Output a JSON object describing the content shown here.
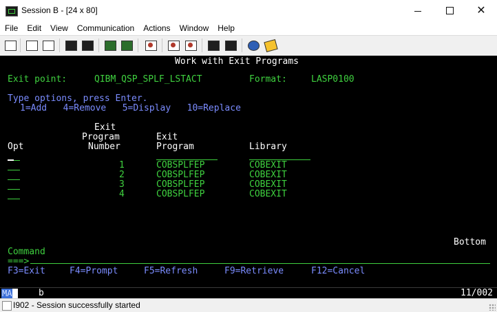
{
  "window": {
    "title": "Session B - [24 x 80]",
    "minimize": "—",
    "maximize": "□",
    "close": "✕"
  },
  "menu": [
    "File",
    "Edit",
    "View",
    "Communication",
    "Actions",
    "Window",
    "Help"
  ],
  "toolbar": {
    "icons": [
      "print-icon",
      "copy-icon",
      "paste-icon",
      "send-icon",
      "receive-icon",
      "display-icon",
      "keypad-icon",
      "record-icon",
      "play-icon",
      "stop-icon",
      "macro-icon",
      "run-macro-icon",
      "globe-icon",
      "note-icon"
    ]
  },
  "terminal": {
    "screen_title": "Work with Exit Programs",
    "exit_point_label": "Exit point:",
    "exit_point_value": "QIBM_QSP_SPLF_LSTACT",
    "format_label": "Format:",
    "format_value": "LASP0100",
    "instructions": "Type options, press Enter.",
    "options": "1=Add   4=Remove   5=Display   10=Replace",
    "headers": {
      "exit_top": "Exit",
      "program_mid": "Program",
      "opt": "Opt",
      "number": "Number",
      "exit2": "Exit",
      "program": "Program",
      "library": "Library"
    },
    "rows": [
      {
        "number": "1",
        "program": "COBSPLFEP",
        "library": "COBEXIT"
      },
      {
        "number": "2",
        "program": "COBSPLFEP",
        "library": "COBEXIT"
      },
      {
        "number": "3",
        "program": "COBSPLFEP",
        "library": "COBEXIT"
      },
      {
        "number": "4",
        "program": "COBSPLFEP",
        "library": "COBEXIT"
      }
    ],
    "bottom_indicator": "Bottom",
    "command_label": "Command",
    "command_prompt": "===>",
    "function_keys": [
      "F3=Exit",
      "F4=Prompt",
      "F5=Refresh",
      "F9=Retrieve",
      "F12=Cancel"
    ]
  },
  "oia": {
    "mode": "MA",
    "indicator": "b",
    "cursor_position": "11/002"
  },
  "status": {
    "message": "I902 - Session successfully started"
  },
  "colors": {
    "terminal_bg": "#000000",
    "green": "#3fd13f",
    "blue": "#7b8cff",
    "white": "#ffffff"
  }
}
